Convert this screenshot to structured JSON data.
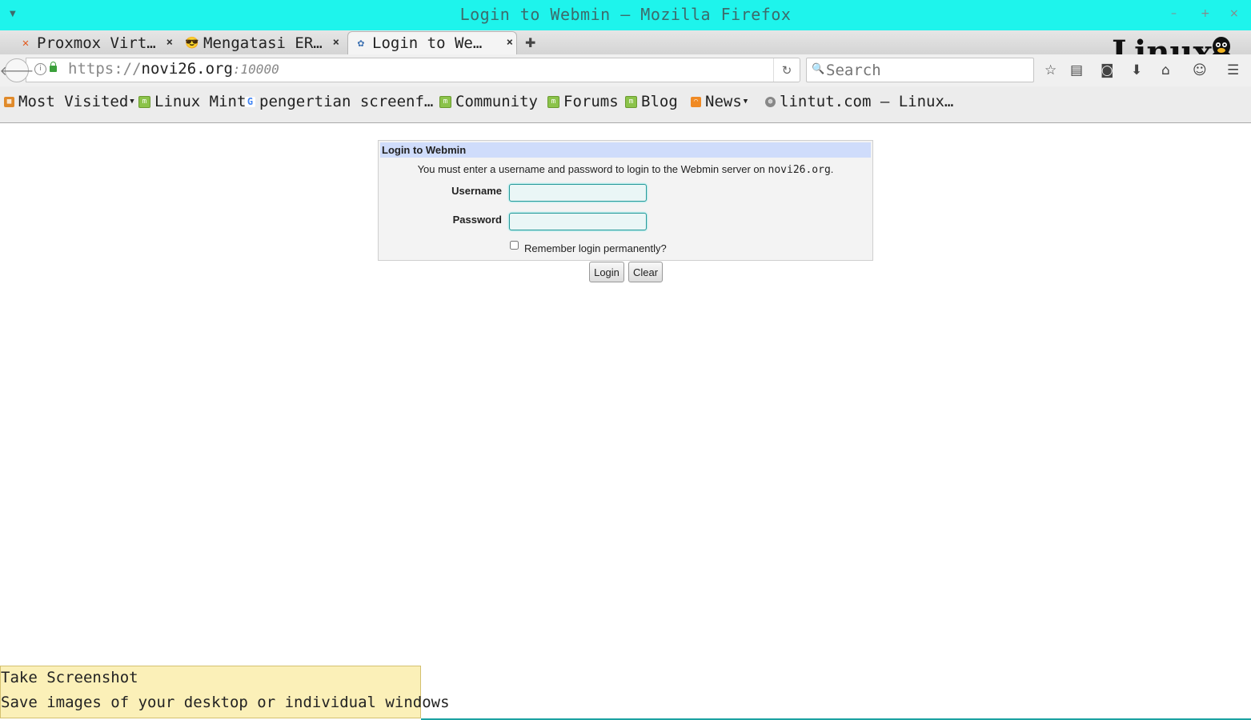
{
  "window": {
    "title": "Login to Webmin — Mozilla Firefox",
    "controls": {
      "minimize": "–",
      "maximize": "+",
      "close": "×"
    }
  },
  "tabs": [
    {
      "label": "Proxmox Virt…",
      "icon": "proxmox-icon",
      "active": false
    },
    {
      "label": "Mengatasi ER…",
      "icon": "face-icon",
      "active": false
    },
    {
      "label": "Login to We…",
      "icon": "webmin-icon",
      "active": true
    }
  ],
  "navbar": {
    "url_prefix": "https://",
    "url_host": "novi26.org",
    "url_port": ":10000",
    "search_placeholder": "Search"
  },
  "logo": {
    "text": "Linux"
  },
  "bookmarks": [
    {
      "label": "Most Visited",
      "icon": "folder-icon",
      "dropdown": true
    },
    {
      "label": "Linux Mint",
      "icon": "mint-icon"
    },
    {
      "label": "pengertian screenf…",
      "icon": "google-icon"
    },
    {
      "label": "Community",
      "icon": "mint-icon"
    },
    {
      "label": "Forums",
      "icon": "mint-icon"
    },
    {
      "label": "Blog",
      "icon": "mint-icon"
    },
    {
      "label": "News",
      "icon": "rss-icon",
      "dropdown": true
    },
    {
      "label": "lintut.com – Linux…",
      "icon": "globe-icon"
    }
  ],
  "login": {
    "header": "Login to Webmin",
    "message_prefix": "You must enter a username and password to login to the Webmin server on",
    "host": "novi26.org",
    "message_suffix": ".",
    "username_label": "Username",
    "username_value": "",
    "password_label": "Password",
    "password_value": "",
    "remember_label": "Remember login permanently?",
    "remember_checked": false,
    "login_button": "Login",
    "clear_button": "Clear"
  },
  "tooltip": {
    "title": "Take Screenshot",
    "description": "Save images of your desktop or individual windows"
  },
  "colors": {
    "titlebar": "#1ef4ec",
    "panel_header": "#cfdcfb",
    "tooltip_bg": "#fbf0b8"
  }
}
